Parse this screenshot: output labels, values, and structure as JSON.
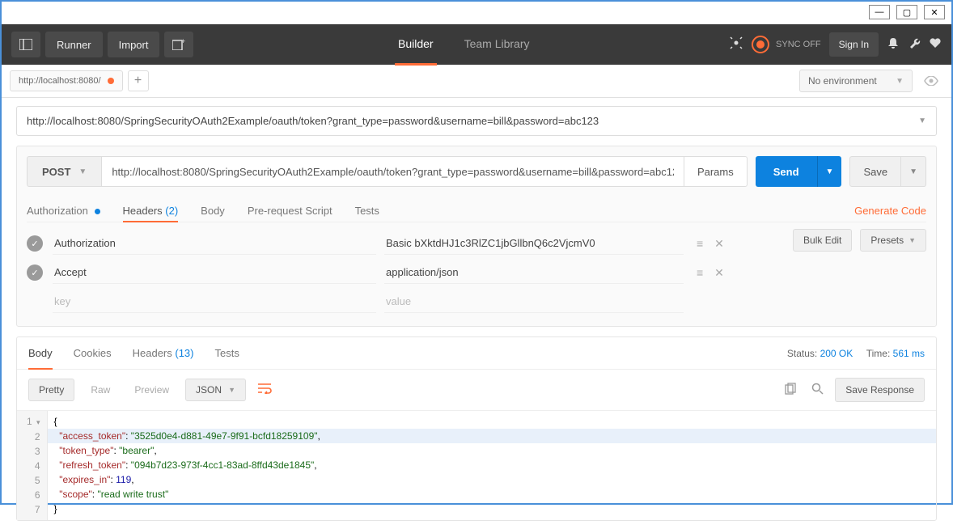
{
  "window_controls": {
    "min": "—",
    "max": "▢",
    "close": "✕"
  },
  "header": {
    "runner": "Runner",
    "import": "Import",
    "builder": "Builder",
    "team_library": "Team Library",
    "sync_off": "SYNC OFF",
    "sign_in": "Sign In"
  },
  "tabs": {
    "tab1": "http://localhost:8080/",
    "add": "+"
  },
  "environment": {
    "label": "No environment"
  },
  "request": {
    "history_url": "http://localhost:8080/SpringSecurityOAuth2Example/oauth/token?grant_type=password&username=bill&password=abc123",
    "method": "POST",
    "url": "http://localhost:8080/SpringSecurityOAuth2Example/oauth/token?grant_type=password&username=bill&password=abc123",
    "params_btn": "Params",
    "send_btn": "Send",
    "save_btn": "Save"
  },
  "req_tabs": {
    "auth": "Authorization",
    "headers": "Headers",
    "headers_count": "(2)",
    "body": "Body",
    "prescript": "Pre-request Script",
    "tests": "Tests",
    "generate": "Generate Code"
  },
  "headers": [
    {
      "key": "Authorization",
      "value": "Basic bXktdHJ1c3RlZC1jbGllbnQ6c2VjcmV0"
    },
    {
      "key": "Accept",
      "value": "application/json"
    }
  ],
  "header_placeholder": {
    "key": "key",
    "value": "value"
  },
  "bulk_edit": "Bulk Edit",
  "presets": "Presets",
  "resp_tabs": {
    "body": "Body",
    "cookies": "Cookies",
    "headers": "Headers",
    "headers_count": "(13)",
    "tests": "Tests"
  },
  "resp_status": {
    "status_label": "Status:",
    "status_val": "200 OK",
    "time_label": "Time:",
    "time_val": "561 ms"
  },
  "resp_toolbar": {
    "pretty": "Pretty",
    "raw": "Raw",
    "preview": "Preview",
    "json": "JSON",
    "save_response": "Save Response"
  },
  "response_body": {
    "access_token": "3525d0e4-d881-49e7-9f91-bcfd18259109",
    "token_type": "bearer",
    "refresh_token": "094b7d23-973f-4cc1-83ad-8ffd43de1845",
    "expires_in": 119,
    "scope": "read write trust"
  }
}
